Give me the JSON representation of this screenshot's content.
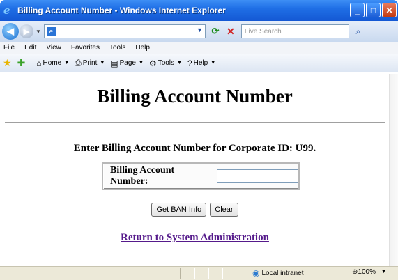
{
  "window": {
    "title": "Billing Account Number - Windows Internet Explorer"
  },
  "addressbar": {
    "url": "",
    "search_placeholder": "Live Search"
  },
  "menu": [
    "File",
    "Edit",
    "View",
    "Favorites",
    "Tools",
    "Help"
  ],
  "commands": {
    "home": "Home",
    "print": "Print",
    "page": "Page",
    "tools": "Tools",
    "help": "Help"
  },
  "page": {
    "title": "Billing Account Number",
    "prompt": "Enter Billing Account Number for Corporate ID: U99.",
    "field_label": "Billing Account Number:",
    "field_value": "",
    "get_button": "Get BAN Info",
    "clear_button": "Clear",
    "return_link": "Return to System Administration"
  },
  "status": {
    "zone": "Local intranet",
    "zoom": "100%"
  }
}
